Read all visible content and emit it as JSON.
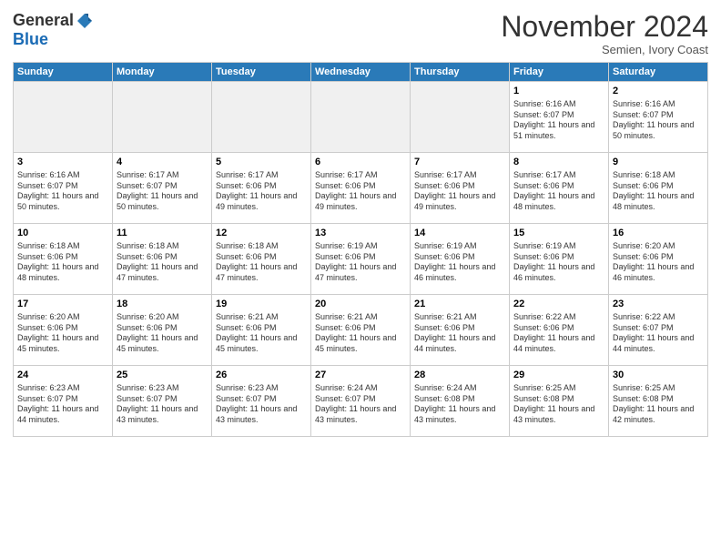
{
  "header": {
    "logo_general": "General",
    "logo_blue": "Blue",
    "month_title": "November 2024",
    "subtitle": "Semien, Ivory Coast"
  },
  "weekdays": [
    "Sunday",
    "Monday",
    "Tuesday",
    "Wednesday",
    "Thursday",
    "Friday",
    "Saturday"
  ],
  "weeks": [
    [
      {
        "day": "",
        "empty": true
      },
      {
        "day": "",
        "empty": true
      },
      {
        "day": "",
        "empty": true
      },
      {
        "day": "",
        "empty": true
      },
      {
        "day": "",
        "empty": true
      },
      {
        "day": "1",
        "sunrise": "6:16 AM",
        "sunset": "6:07 PM",
        "daylight": "11 hours and 51 minutes."
      },
      {
        "day": "2",
        "sunrise": "6:16 AM",
        "sunset": "6:07 PM",
        "daylight": "11 hours and 50 minutes."
      }
    ],
    [
      {
        "day": "3",
        "sunrise": "6:16 AM",
        "sunset": "6:07 PM",
        "daylight": "11 hours and 50 minutes."
      },
      {
        "day": "4",
        "sunrise": "6:17 AM",
        "sunset": "6:07 PM",
        "daylight": "11 hours and 50 minutes."
      },
      {
        "day": "5",
        "sunrise": "6:17 AM",
        "sunset": "6:06 PM",
        "daylight": "11 hours and 49 minutes."
      },
      {
        "day": "6",
        "sunrise": "6:17 AM",
        "sunset": "6:06 PM",
        "daylight": "11 hours and 49 minutes."
      },
      {
        "day": "7",
        "sunrise": "6:17 AM",
        "sunset": "6:06 PM",
        "daylight": "11 hours and 49 minutes."
      },
      {
        "day": "8",
        "sunrise": "6:17 AM",
        "sunset": "6:06 PM",
        "daylight": "11 hours and 48 minutes."
      },
      {
        "day": "9",
        "sunrise": "6:18 AM",
        "sunset": "6:06 PM",
        "daylight": "11 hours and 48 minutes."
      }
    ],
    [
      {
        "day": "10",
        "sunrise": "6:18 AM",
        "sunset": "6:06 PM",
        "daylight": "11 hours and 48 minutes."
      },
      {
        "day": "11",
        "sunrise": "6:18 AM",
        "sunset": "6:06 PM",
        "daylight": "11 hours and 47 minutes."
      },
      {
        "day": "12",
        "sunrise": "6:18 AM",
        "sunset": "6:06 PM",
        "daylight": "11 hours and 47 minutes."
      },
      {
        "day": "13",
        "sunrise": "6:19 AM",
        "sunset": "6:06 PM",
        "daylight": "11 hours and 47 minutes."
      },
      {
        "day": "14",
        "sunrise": "6:19 AM",
        "sunset": "6:06 PM",
        "daylight": "11 hours and 46 minutes."
      },
      {
        "day": "15",
        "sunrise": "6:19 AM",
        "sunset": "6:06 PM",
        "daylight": "11 hours and 46 minutes."
      },
      {
        "day": "16",
        "sunrise": "6:20 AM",
        "sunset": "6:06 PM",
        "daylight": "11 hours and 46 minutes."
      }
    ],
    [
      {
        "day": "17",
        "sunrise": "6:20 AM",
        "sunset": "6:06 PM",
        "daylight": "11 hours and 45 minutes."
      },
      {
        "day": "18",
        "sunrise": "6:20 AM",
        "sunset": "6:06 PM",
        "daylight": "11 hours and 45 minutes."
      },
      {
        "day": "19",
        "sunrise": "6:21 AM",
        "sunset": "6:06 PM",
        "daylight": "11 hours and 45 minutes."
      },
      {
        "day": "20",
        "sunrise": "6:21 AM",
        "sunset": "6:06 PM",
        "daylight": "11 hours and 45 minutes."
      },
      {
        "day": "21",
        "sunrise": "6:21 AM",
        "sunset": "6:06 PM",
        "daylight": "11 hours and 44 minutes."
      },
      {
        "day": "22",
        "sunrise": "6:22 AM",
        "sunset": "6:06 PM",
        "daylight": "11 hours and 44 minutes."
      },
      {
        "day": "23",
        "sunrise": "6:22 AM",
        "sunset": "6:07 PM",
        "daylight": "11 hours and 44 minutes."
      }
    ],
    [
      {
        "day": "24",
        "sunrise": "6:23 AM",
        "sunset": "6:07 PM",
        "daylight": "11 hours and 44 minutes."
      },
      {
        "day": "25",
        "sunrise": "6:23 AM",
        "sunset": "6:07 PM",
        "daylight": "11 hours and 43 minutes."
      },
      {
        "day": "26",
        "sunrise": "6:23 AM",
        "sunset": "6:07 PM",
        "daylight": "11 hours and 43 minutes."
      },
      {
        "day": "27",
        "sunrise": "6:24 AM",
        "sunset": "6:07 PM",
        "daylight": "11 hours and 43 minutes."
      },
      {
        "day": "28",
        "sunrise": "6:24 AM",
        "sunset": "6:08 PM",
        "daylight": "11 hours and 43 minutes."
      },
      {
        "day": "29",
        "sunrise": "6:25 AM",
        "sunset": "6:08 PM",
        "daylight": "11 hours and 43 minutes."
      },
      {
        "day": "30",
        "sunrise": "6:25 AM",
        "sunset": "6:08 PM",
        "daylight": "11 hours and 42 minutes."
      }
    ]
  ]
}
